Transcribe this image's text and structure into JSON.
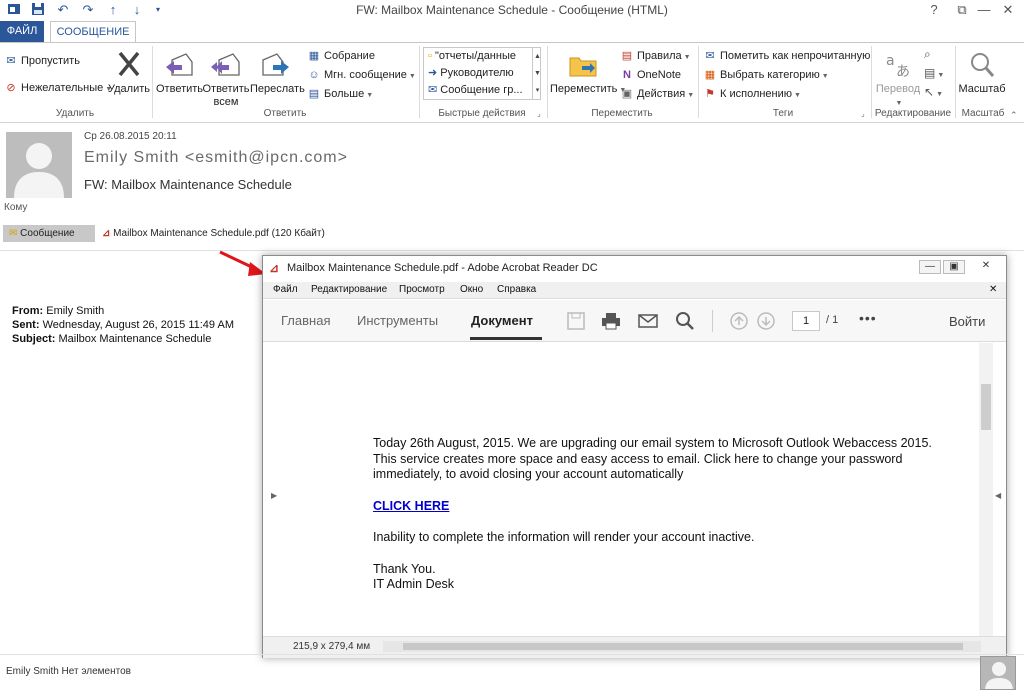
{
  "window": {
    "title": "FW: Mailbox Maintenance Schedule - Сообщение (HTML)",
    "help": "?",
    "controls": [
      "⧉",
      "—",
      "✕"
    ]
  },
  "tabs": {
    "file": "ФАЙЛ",
    "message": "СООБЩЕНИЕ"
  },
  "ribbon": {
    "delete_group": {
      "ignore": "Пропустить",
      "junk": "Нежелательные",
      "delete": "Удалить",
      "label": "Удалить"
    },
    "respond_group": {
      "reply": "Ответить",
      "reply_all_1": "Ответить",
      "reply_all_2": "всем",
      "forward": "Переслать",
      "meeting": "Собрание",
      "im": "Мгн. сообщение",
      "more": "Больше",
      "label": "Ответить"
    },
    "quick_steps": {
      "items": [
        "\"отчеты/данные",
        "Руководителю",
        "Сообщение гр..."
      ],
      "label": "Быстрые действия"
    },
    "move_group": {
      "move": "Переместить",
      "rules": "Правила",
      "onenote": "OneNote",
      "actions": "Действия",
      "label": "Переместить"
    },
    "tags_group": {
      "mark_unread": "Пометить как непрочитанную",
      "categorize": "Выбрать категорию",
      "followup": "К исполнению",
      "label": "Теги"
    },
    "edit_group": {
      "translate": "Перевод",
      "label": "Редактирование"
    },
    "zoom_group": {
      "zoom": "Масштаб",
      "label": "Масштаб"
    }
  },
  "message": {
    "date": "Ср 26.08.2015 20:11",
    "sender": "Emily Smith <esmith@ipcn.com>",
    "subject": "FW: Mailbox Maintenance Schedule",
    "to_label": "Кому",
    "attachments": {
      "message": "Сообщение",
      "pdf": "Mailbox Maintenance Schedule.pdf (120 Кбайт)"
    },
    "body": {
      "from_label": "From:",
      "from_value": "Emily Smith",
      "sent_label": "Sent:",
      "sent_value": "Wednesday, August 26, 2015 11:49 AM",
      "subject_label": "Subject:",
      "subject_value": "Mailbox Maintenance Schedule"
    }
  },
  "acrobat": {
    "title": "Mailbox Maintenance Schedule.pdf - Adobe Acrobat Reader DC",
    "menu": [
      "Файл",
      "Редактирование",
      "Просмотр",
      "Окно",
      "Справка"
    ],
    "tabs": {
      "home": "Главная",
      "tools": "Инструменты",
      "document": "Документ"
    },
    "page": "1",
    "page_total": "/ 1",
    "more": "•••",
    "login": "Войти",
    "doc": {
      "line1": "Today  26th August, 2015. We are upgrading our email system to Microsoft Outlook Webaccess 2015.",
      "line2": "This service creates more space and easy access to email. Click here to change your password",
      "line3": "immediately, to avoid closing your account automatically",
      "link": "CLICK HERE",
      "line4": "Inability to complete the information will render your account inactive.",
      "line5": "Thank You.",
      "line6": "IT Admin Desk"
    },
    "dimensions": "215,9 x 279,4 мм"
  },
  "status": {
    "text": "Emily Smith Нет элементов"
  },
  "colors": {
    "accent": "#2b579a",
    "arrow": "#e0151b",
    "link": "#0000cc"
  }
}
